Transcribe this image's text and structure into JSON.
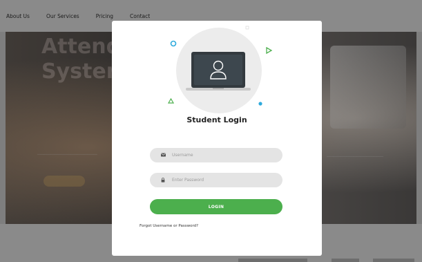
{
  "nav": {
    "items": [
      "About Us",
      "Our Services",
      "Pricing",
      "Contact"
    ]
  },
  "hero": {
    "title": "Attend\nSyster"
  },
  "modal": {
    "title": "Student Login",
    "username_placeholder": "Username",
    "password_placeholder": "Enter Password",
    "login_label": "LOGIN",
    "forgot_label": "Forgot Username or Password?"
  },
  "colors": {
    "accent_green": "#4caf4d",
    "accent_blue": "#2eaadc",
    "field_bg": "#e4e4e4"
  }
}
